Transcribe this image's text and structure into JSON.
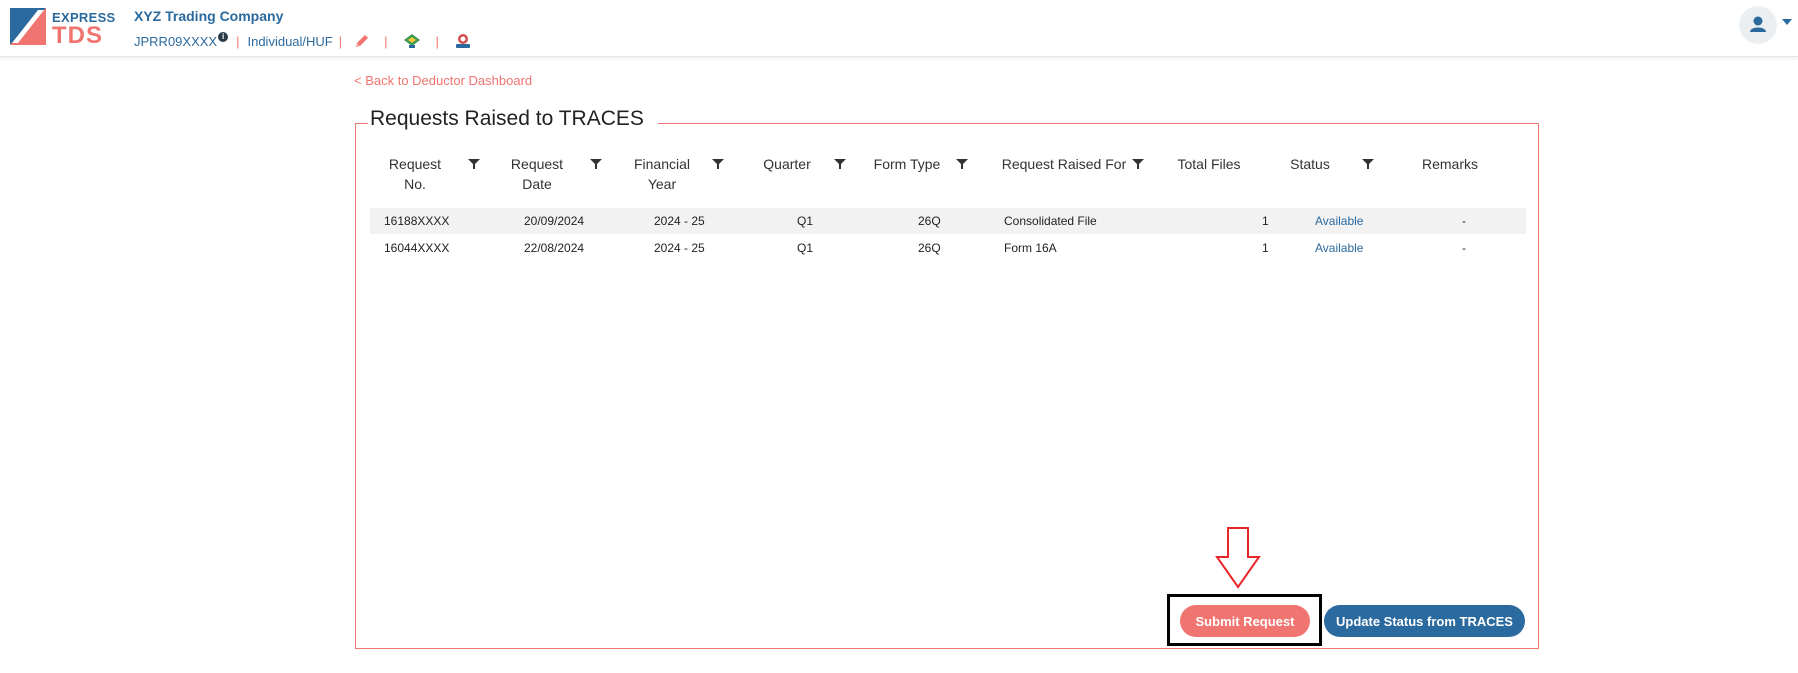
{
  "brand": {
    "express": "EXPRESS",
    "tds": "TDS"
  },
  "header": {
    "company": "XYZ Trading Company",
    "pan": "JPRR09XXXX",
    "info_icon": "i",
    "entity_type": "Individual/HUF",
    "separator": "|"
  },
  "nav": {
    "back_label": "< Back to Deductor Dashboard"
  },
  "panel": {
    "title": "Requests Raised to TRACES"
  },
  "table": {
    "headers": {
      "request_no": [
        "Request",
        "No."
      ],
      "request_date": [
        "Request",
        "Date"
      ],
      "financial_year": [
        "Financial",
        "Year"
      ],
      "quarter": "Quarter",
      "form_type": "Form Type",
      "raised_for": "Request Raised For",
      "total_files": "Total Files",
      "status": "Status",
      "remarks": "Remarks"
    },
    "rows": [
      {
        "request_no": "16188XXXX",
        "request_date": "20/09/2024",
        "financial_year": "2024 - 25",
        "quarter": "Q1",
        "form_type": "26Q",
        "raised_for": "Consolidated File",
        "total_files": "1",
        "status": "Available",
        "remarks": "-"
      },
      {
        "request_no": "16044XXXX",
        "request_date": "22/08/2024",
        "financial_year": "2024 - 25",
        "quarter": "Q1",
        "form_type": "26Q",
        "raised_for": "Form 16A",
        "total_files": "1",
        "status": "Available",
        "remarks": "-"
      }
    ]
  },
  "actions": {
    "submit_label": "Submit Request",
    "update_label": "Update Status from TRACES"
  },
  "icons": {
    "logo": "express-tds-logo",
    "edit": "pencil-icon",
    "gst": "gst-icon",
    "traces": "traces-icon",
    "user": "user-icon",
    "filter": "filter-icon",
    "annotation": "down-arrow-icon"
  },
  "colors": {
    "primary": "#2b6a9e",
    "accent": "#f07470",
    "stripe": "#f2f2f2"
  }
}
